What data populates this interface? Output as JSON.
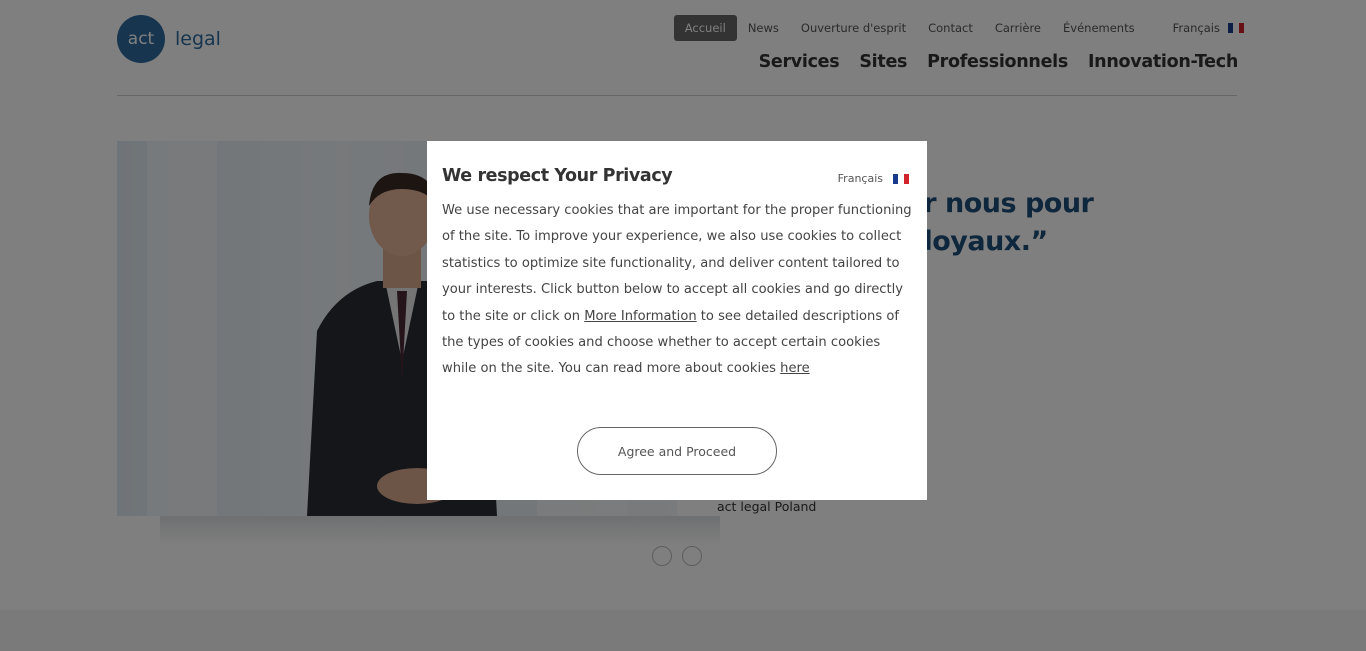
{
  "logo": {
    "mark": "act",
    "text": "legal"
  },
  "topnav": {
    "items": [
      "Accueil",
      "News",
      "Ouverture d'esprit",
      "Contact",
      "Carrière",
      "Événements"
    ],
    "language": "Français"
  },
  "mainnav": {
    "items": [
      "Services",
      "Sites",
      "Professionnels",
      "Innovation-Tech"
    ]
  },
  "hero": {
    "quote_line1": "nt compter sur nous pour",
    "quote_line2": "res solides et loyaux.”",
    "author": "act legal Poland"
  },
  "modal": {
    "title": "We respect Your Privacy",
    "language": "Français",
    "body_part1": "We use necessary cookies that are important for the proper functioning of the site. To improve your experience, we also use cookies to collect statistics to optimize site functionality, and deliver content tailored to your interests. Click button below to accept all cookies and go directly to the site or click on ",
    "more_info_link": "More Information",
    "body_part2": " to see detailed descriptions of the types of cookies and choose whether to accept certain cookies while on the site. You can read more about cookies ",
    "here_link": "here",
    "agree_button": "Agree and Proceed"
  },
  "colors": {
    "brand": "#2e6b9e",
    "overlay": "rgba(0,0,0,0.5)",
    "quote": "#1f4e7a"
  }
}
